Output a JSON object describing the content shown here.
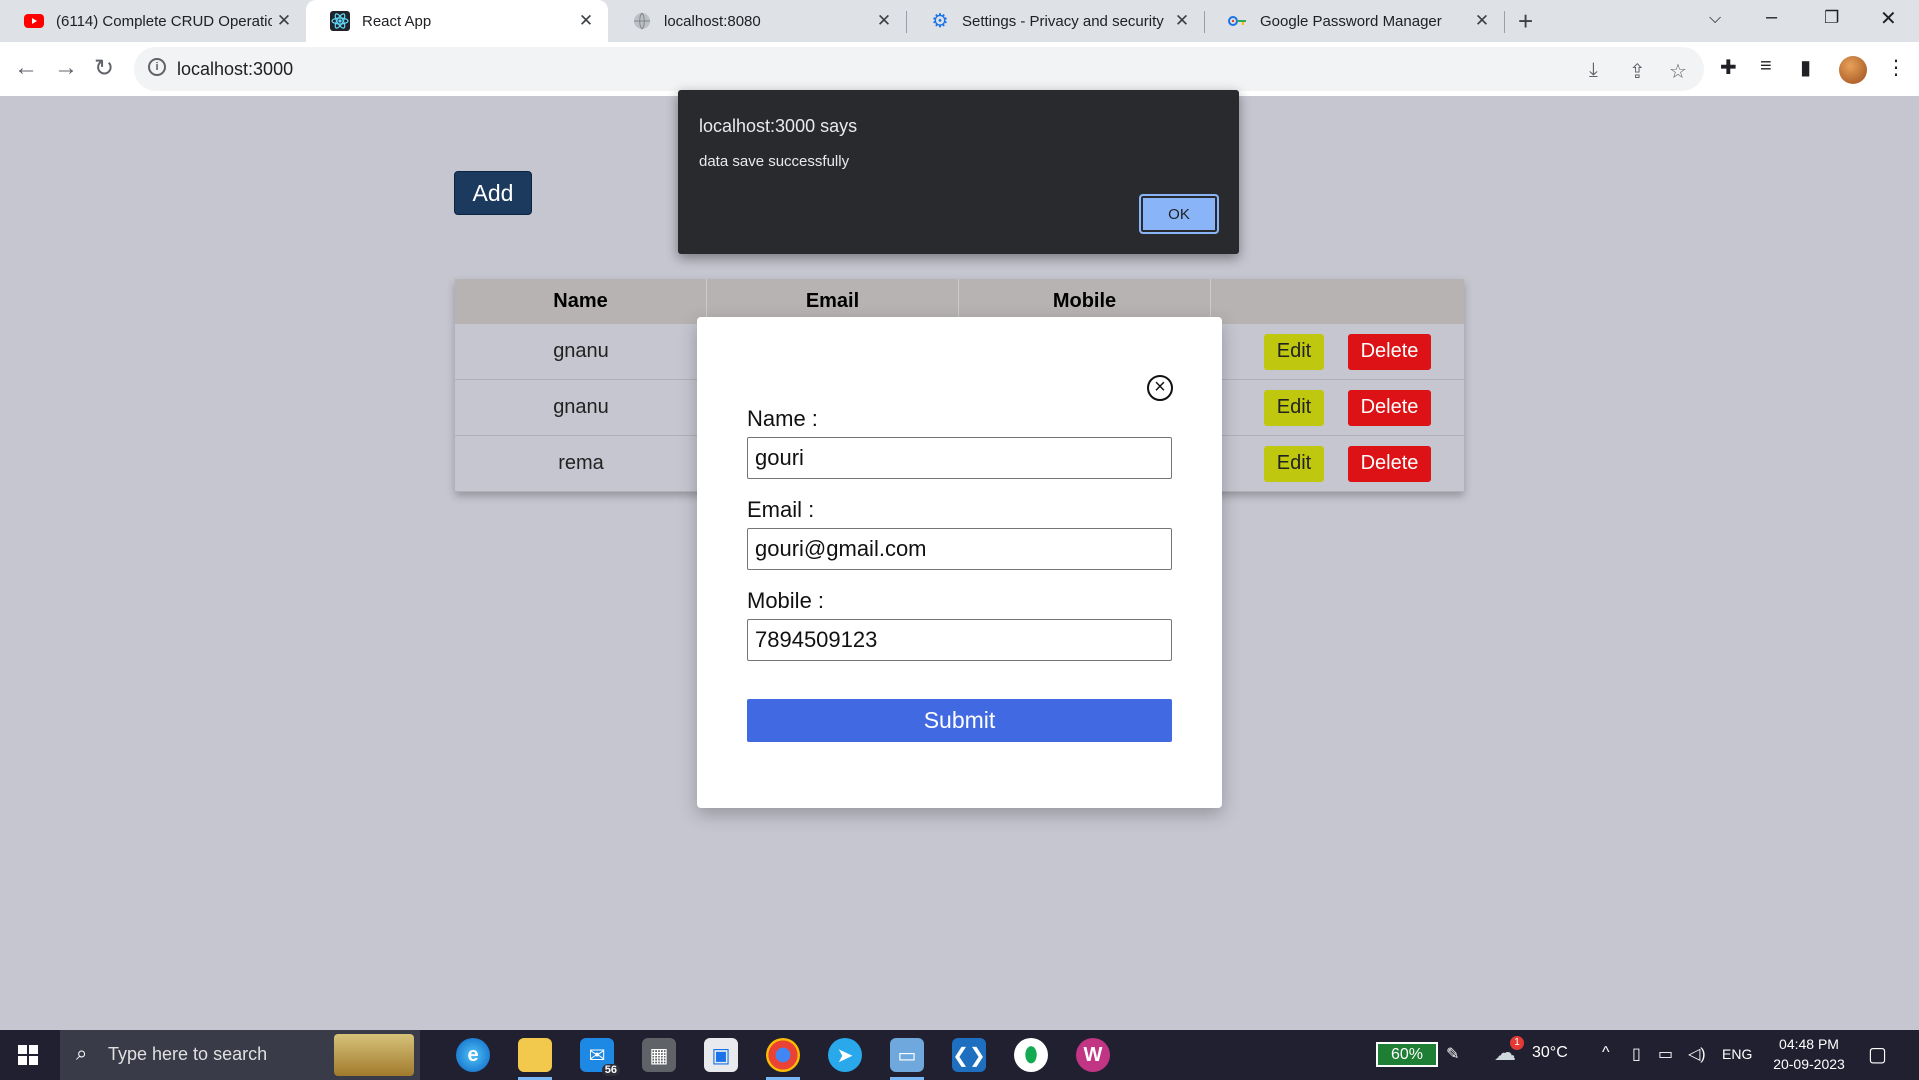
{
  "browser": {
    "tabs": [
      {
        "title": "(6114) Complete CRUD Operatio",
        "icon": "youtube-icon"
      },
      {
        "title": "React App",
        "icon": "react-icon"
      },
      {
        "title": "localhost:8080",
        "icon": "globe-icon"
      },
      {
        "title": "Settings - Privacy and security",
        "icon": "gear-icon"
      },
      {
        "title": "Google Password Manager",
        "icon": "key-icon"
      }
    ],
    "url": "localhost:3000"
  },
  "page": {
    "add_label": "Add",
    "table": {
      "headers": [
        "Name",
        "Email",
        "Mobile"
      ],
      "rows": [
        {
          "name": "gnanu"
        },
        {
          "name": "gnanu"
        },
        {
          "name": "rema"
        }
      ],
      "edit_label": "Edit",
      "delete_label": "Delete"
    }
  },
  "modal": {
    "name_label": "Name :",
    "name_value": "gouri",
    "email_label": "Email :",
    "email_value": "gouri@gmail.com",
    "mobile_label": "Mobile :",
    "mobile_value": "7894509123",
    "submit_label": "Submit",
    "close_icon": "close-circle-icon"
  },
  "alert": {
    "title": "localhost:3000 says",
    "message": "data save successfully",
    "ok_label": "OK"
  },
  "taskbar": {
    "search_placeholder": "Type here to search",
    "mail_badge": "56",
    "battery": "60%",
    "weather_badge": "1",
    "temperature": "30°C",
    "language": "ENG",
    "time": "04:48 PM",
    "date": "20-09-2023"
  },
  "colors": {
    "page_bg": "#c6c6d1",
    "add_button": "#1c3a5e",
    "edit_button": "#bfc80e",
    "delete_button": "#dd1216",
    "submit_button": "#4169e1",
    "alert_bg": "#292a2d",
    "ok_button": "#8ab4f8"
  }
}
